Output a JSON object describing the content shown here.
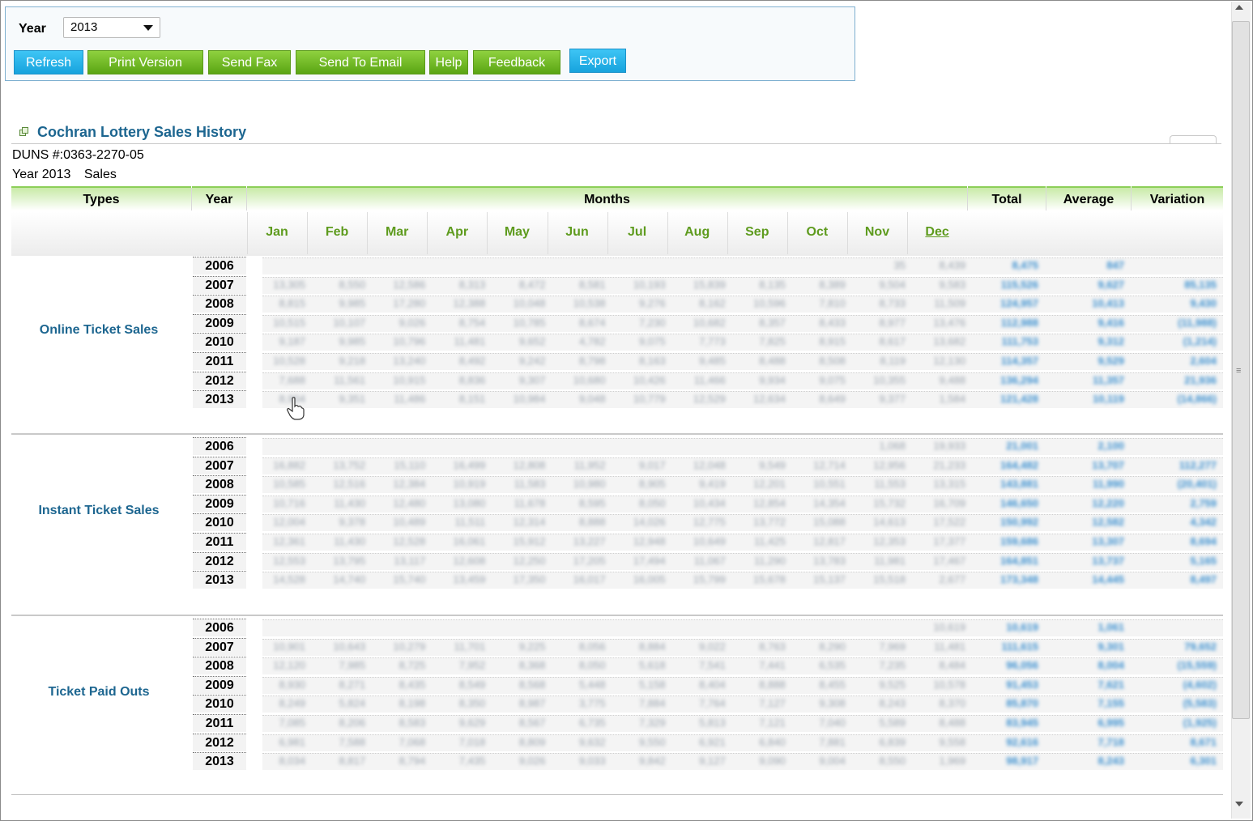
{
  "toolbar": {
    "year_label": "Year",
    "year_value": "2013",
    "buttons": {
      "refresh": "Refresh",
      "print": "Print Version",
      "fax": "Send Fax",
      "email": "Send To Email",
      "help": "Help",
      "feedback": "Feedback",
      "export": "Export"
    }
  },
  "report": {
    "title": "Cochran Lottery Sales History",
    "duns": "DUNS #:0363-2270-05",
    "year_text": "Year 2013",
    "sales_text": "Sales"
  },
  "headers": {
    "types": "Types",
    "year": "Year",
    "months": "Months",
    "total": "Total",
    "average": "Average",
    "variation": "Variation"
  },
  "months": [
    "Jan",
    "Feb",
    "Mar",
    "Apr",
    "May",
    "Jun",
    "Jul",
    "Aug",
    "Sep",
    "Oct",
    "Nov",
    "Dec"
  ],
  "groups": [
    {
      "name": "Online Ticket Sales",
      "years": [
        "2006",
        "2007",
        "2008",
        "2009",
        "2010",
        "2011",
        "2012",
        "2013"
      ],
      "rows": [
        [
          "",
          "",
          "",
          "",
          "",
          "",
          "",
          "",
          "",
          "",
          "35",
          "8,439",
          "8,475",
          "847",
          ""
        ],
        [
          "13,305",
          "8,550",
          "12,586",
          "8,313",
          "8,472",
          "8,581",
          "10,193",
          "15,839",
          "8,135",
          "8,389",
          "9,504",
          "9,583",
          "115,526",
          "9,627",
          "85,135"
        ],
        [
          "8,815",
          "9,985",
          "17,280",
          "12,388",
          "10,048",
          "10,538",
          "9,276",
          "8,162",
          "10,596",
          "7,810",
          "8,733",
          "11,509",
          "124,957",
          "10,413",
          "9,430"
        ],
        [
          "10,515",
          "10,107",
          "9,026",
          "8,754",
          "10,785",
          "8,674",
          "7,230",
          "10,682",
          "8,357",
          "8,433",
          "8,977",
          "13,476",
          "112,988",
          "9,416",
          "(11,988)"
        ],
        [
          "9,187",
          "9,985",
          "10,796",
          "11,481",
          "9,652",
          "4,782",
          "9,075",
          "7,773",
          "7,825",
          "8,915",
          "8,617",
          "13,682",
          "111,753",
          "9,312",
          "(1,214)"
        ],
        [
          "10,528",
          "9,218",
          "13,240",
          "8,492",
          "9,242",
          "8,798",
          "8,163",
          "9,485",
          "8,488",
          "8,508",
          "8,119",
          "12,130",
          "114,357",
          "9,529",
          "2,604"
        ],
        [
          "7,688",
          "11,561",
          "10,915",
          "8,836",
          "9,307",
          "10,680",
          "10,426",
          "11,466",
          "9,934",
          "9,075",
          "10,355",
          "9,488",
          "136,294",
          "11,357",
          "21,936"
        ],
        [
          "8,904",
          "9,351",
          "11,486",
          "8,151",
          "10,984",
          "9,048",
          "10,779",
          "12,529",
          "12,634",
          "8,649",
          "9,377",
          "1,584",
          "121,428",
          "10,119",
          "(14,866)"
        ]
      ]
    },
    {
      "name": "Instant Ticket Sales",
      "years": [
        "2006",
        "2007",
        "2008",
        "2009",
        "2010",
        "2011",
        "2012",
        "2013"
      ],
      "rows": [
        [
          "",
          "",
          "",
          "",
          "",
          "",
          "",
          "",
          "",
          "",
          "1,068",
          "19,933",
          "21,001",
          "2,100",
          ""
        ],
        [
          "16,882",
          "13,752",
          "15,110",
          "16,499",
          "12,808",
          "11,952",
          "9,017",
          "12,048",
          "9,549",
          "12,714",
          "12,956",
          "21,233",
          "164,482",
          "13,707",
          "112,277"
        ],
        [
          "10,585",
          "12,516",
          "12,384",
          "10,919",
          "11,583",
          "10,980",
          "8,905",
          "9,419",
          "12,201",
          "10,551",
          "11,553",
          "13,315",
          "143,881",
          "11,990",
          "(20,401)"
        ],
        [
          "10,716",
          "11,430",
          "12,480",
          "13,080",
          "11,678",
          "8,595",
          "8,050",
          "10,434",
          "12,854",
          "14,354",
          "15,732",
          "16,709",
          "146,650",
          "12,220",
          "2,759"
        ],
        [
          "12,004",
          "9,378",
          "10,489",
          "11,511",
          "12,314",
          "8,888",
          "14,026",
          "12,775",
          "13,772",
          "15,088",
          "14,613",
          "17,522",
          "150,992",
          "12,582",
          "4,342"
        ],
        [
          "12,361",
          "11,430",
          "12,528",
          "16,061",
          "15,912",
          "13,227",
          "12,948",
          "10,649",
          "11,425",
          "12,817",
          "12,353",
          "17,377",
          "159,686",
          "13,307",
          "8,694"
        ],
        [
          "12,553",
          "13,795",
          "13,117",
          "12,608",
          "12,250",
          "17,205",
          "17,494",
          "11,067",
          "11,290",
          "13,783",
          "11,981",
          "17,467",
          "164,851",
          "13,737",
          "5,165"
        ],
        [
          "14,528",
          "14,740",
          "15,740",
          "13,459",
          "17,350",
          "16,017",
          "16,005",
          "15,799",
          "15,678",
          "15,137",
          "15,518",
          "2,677",
          "173,348",
          "14,445",
          "8,497"
        ]
      ]
    },
    {
      "name": "Ticket Paid Outs",
      "years": [
        "2006",
        "2007",
        "2008",
        "2009",
        "2010",
        "2011",
        "2012",
        "2013"
      ],
      "rows": [
        [
          "",
          "",
          "",
          "",
          "",
          "",
          "",
          "",
          "",
          "",
          "",
          "10,619",
          "10,619",
          "1,061",
          ""
        ],
        [
          "10,901",
          "10,643",
          "10,279",
          "11,701",
          "9,225",
          "8,056",
          "8,884",
          "9,022",
          "8,763",
          "8,290",
          "7,969",
          "11,481",
          "111,615",
          "9,301",
          "79,652"
        ],
        [
          "12,120",
          "7,985",
          "8,725",
          "7,952",
          "8,368",
          "8,050",
          "5,618",
          "7,541",
          "7,441",
          "6,535",
          "7,235",
          "8,484",
          "96,056",
          "8,004",
          "(15,559)"
        ],
        [
          "8,930",
          "8,271",
          "8,435",
          "8,549",
          "8,568",
          "5,448",
          "5,158",
          "8,404",
          "8,888",
          "8,455",
          "9,525",
          "10,578",
          "91,453",
          "7,621",
          "(4,602)"
        ],
        [
          "8,249",
          "5,824",
          "8,198",
          "8,350",
          "8,987",
          "3,775",
          "7,884",
          "7,764",
          "7,127",
          "9,308",
          "8,243",
          "8,370",
          "85,870",
          "7,155",
          "(5,583)"
        ],
        [
          "7,085",
          "8,206",
          "8,583",
          "9,629",
          "8,567",
          "6,735",
          "7,329",
          "5,813",
          "7,121",
          "7,040",
          "5,589",
          "8,488",
          "83,945",
          "6,995",
          "(1,925)"
        ],
        [
          "6,981",
          "7,588",
          "7,068",
          "7,018",
          "8,809",
          "9,632",
          "9,550",
          "6,921",
          "6,840",
          "7,881",
          "6,839",
          "9,558",
          "92,616",
          "7,718",
          "8,671"
        ],
        [
          "8,034",
          "8,817",
          "8,794",
          "7,435",
          "9,026",
          "9,033",
          "9,842",
          "9,127",
          "9,090",
          "9,004",
          "8,550",
          "1,969",
          "98,917",
          "8,243",
          "6,301"
        ]
      ]
    }
  ]
}
